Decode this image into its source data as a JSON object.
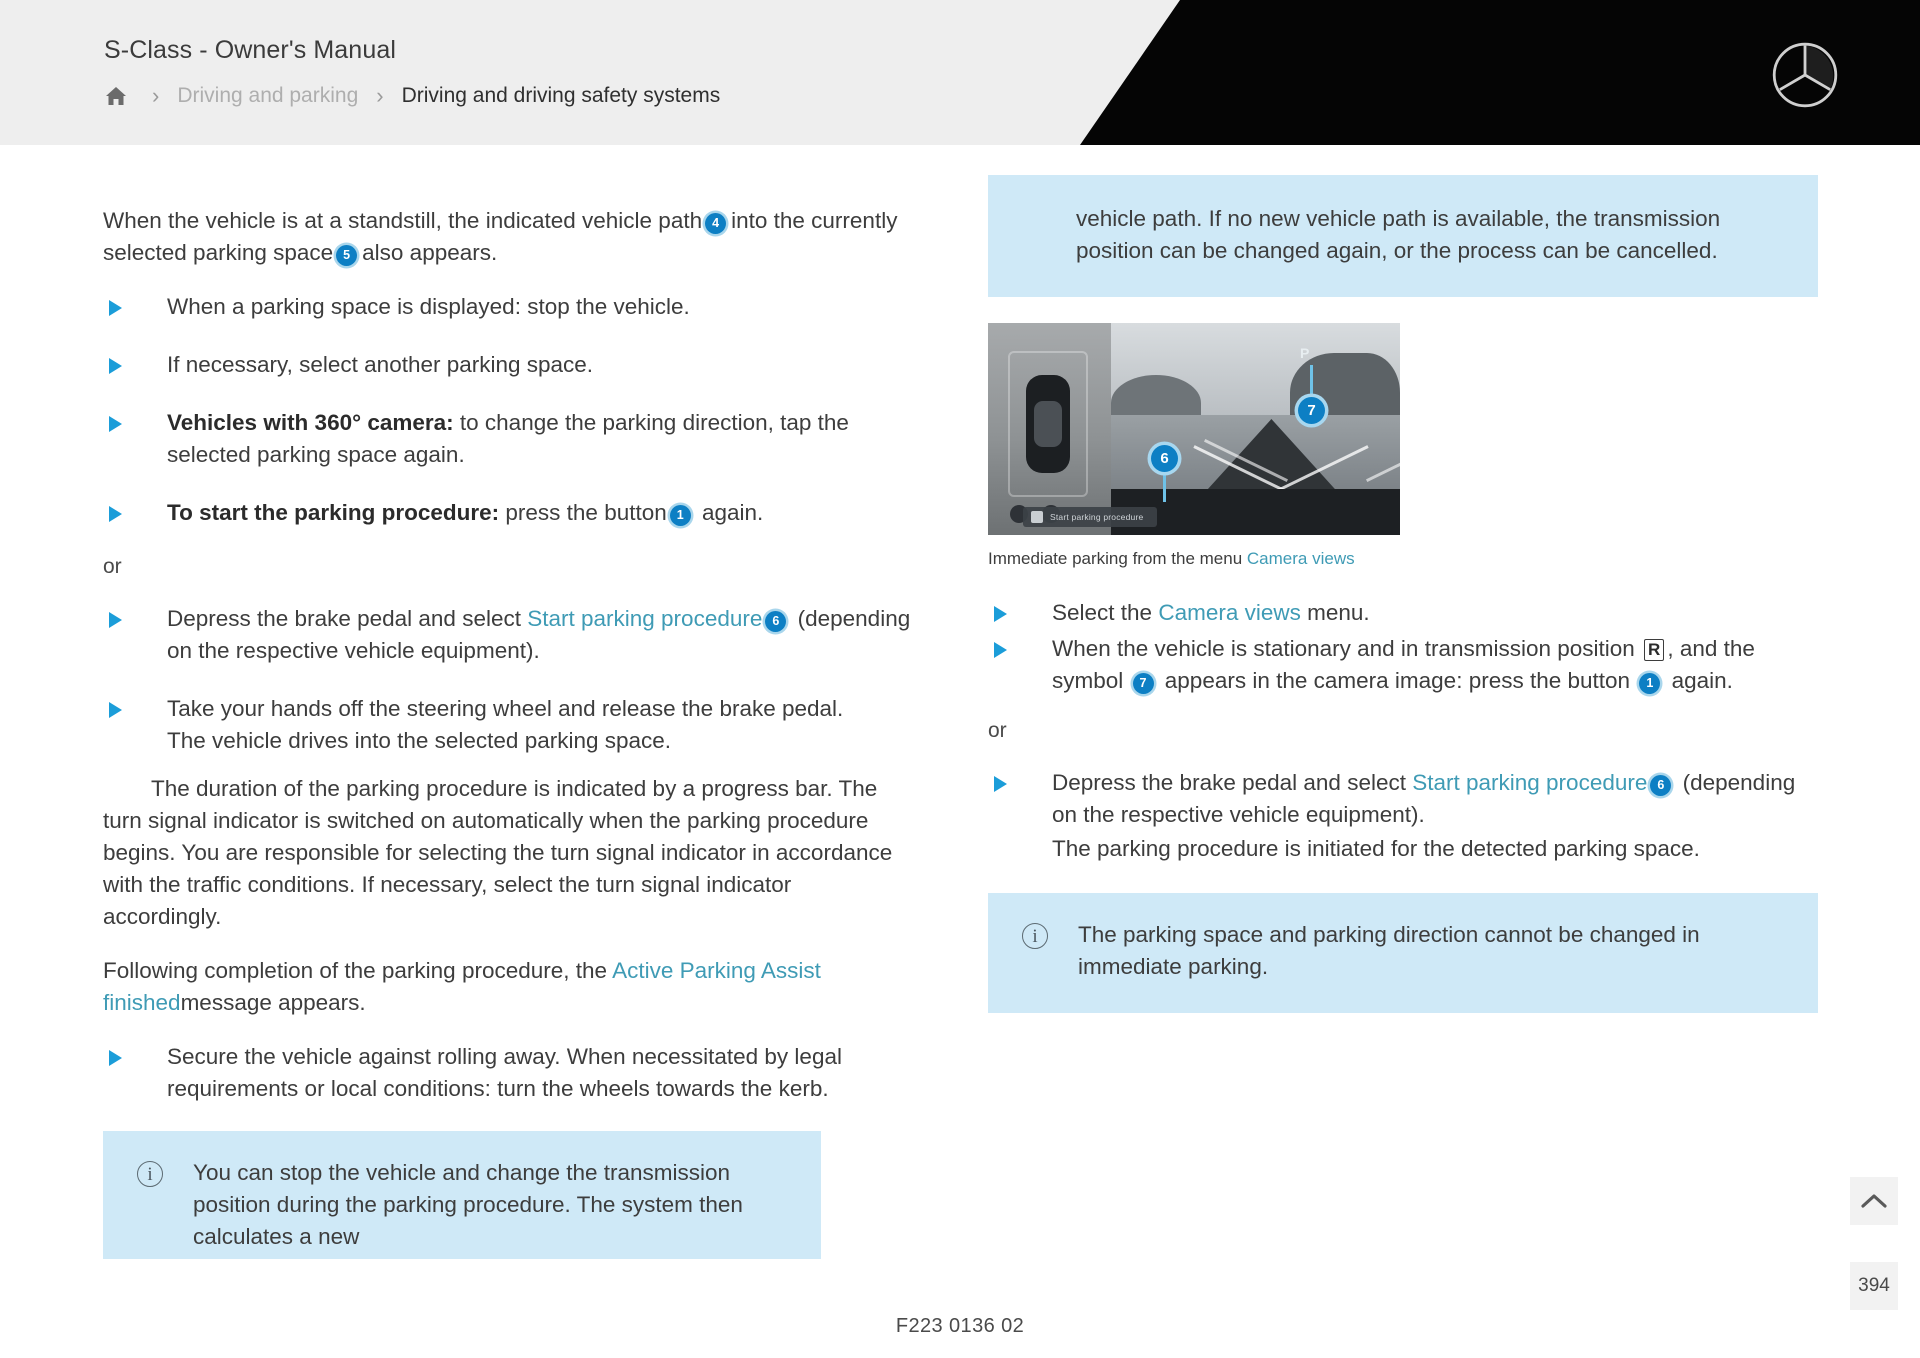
{
  "header": {
    "title": "S-Class - Owner's Manual",
    "home_icon": "home-icon",
    "breadcrumb": {
      "sep": "›",
      "level1": "Driving and parking",
      "level2": "Driving and driving safety systems"
    },
    "brand_logo": "mercedes-star-logo"
  },
  "left_column": {
    "lead_a": "When the vehicle is at a standstill, the indicated vehicle path",
    "lead_n1": "4",
    "lead_b": "into the currently selected parking space",
    "lead_n2": "5",
    "lead_c": "also appears.",
    "bullets": [
      {
        "text": "When a parking space is displayed: stop the vehicle."
      },
      {
        "text": "If necessary, select another parking space."
      },
      {
        "bold": "Vehicles with 360° camera:",
        "text": " to change the parking direction, tap the selected parking space again."
      },
      {
        "bold": "To start the parking procedure:",
        "text": " press the button",
        "num": "1",
        "text_after": " again."
      }
    ],
    "or": "or",
    "bullets2": [
      {
        "pre": "Depress the brake pedal and select ",
        "link": "Start parking procedure",
        "num": "6",
        "post": " (depending on the respective vehicle equipment)."
      },
      {
        "pre": "Take your hands off the steering wheel and release the brake pedal.",
        "sub": "The vehicle drives into the selected parking space."
      }
    ],
    "paragraph1": "The duration of the parking procedure is indicated by a progress bar. The turn signal indicator is switched on automatically when the parking procedure begins. You are responsible for selecting the turn signal indicator in accordance with the traffic conditions. If necessary, select the turn signal indicator accordingly.",
    "paragraph2_pre": "Following completion of the parking procedure, the ",
    "paragraph2_link": "Active Parking Assist finished",
    "paragraph2_post": "message appears.",
    "bullets3": [
      {
        "text": "Secure the vehicle against rolling away. When necessitated by legal requirements or local conditions: turn the wheels towards the kerb."
      }
    ],
    "infobox": {
      "icon": "info-icon",
      "text": "You can stop the vehicle and change the transmission position during the parking procedure. The system then calculates a new"
    }
  },
  "right_column": {
    "infobox_top": {
      "text": "vehicle path. If no new vehicle path is available, the transmission position can be changed again, or the process can be cancelled."
    },
    "figure": {
      "alt": "camera-view-parking-image",
      "button_label": "Start parking procedure",
      "callout_6": "6",
      "callout_7": "7",
      "marker_p": "P",
      "caption_pre": "Immediate parking from the menu ",
      "caption_link": "Camera views"
    },
    "bullets": [
      {
        "pre": "Select the ",
        "link": "Camera views",
        "post": " menu."
      },
      {
        "pre": "When the vehicle is stationary and in transmission position ",
        "boxed": "R",
        "mid": ", and the symbol ",
        "num1": "7",
        "mid2": " appears in the camera image: press the button ",
        "num2": "1",
        "post": " again."
      }
    ],
    "or": "or",
    "bullets2": [
      {
        "pre": "Depress the brake pedal and select ",
        "link": "Start parking procedure",
        "num": "6",
        "post": " (depending on the respective vehicle equipment).",
        "sub": "The parking procedure is initiated for the detected parking space."
      }
    ],
    "infobox_bottom": {
      "icon": "info-icon",
      "text": "The parking space and parking direction cannot be changed in immediate parking."
    }
  },
  "controls": {
    "scroll_up_icon": "chevron-up-icon",
    "page_number": "394"
  },
  "footer": {
    "document_code": "F223 0136 02"
  },
  "colors": {
    "accent_blue": "#0d7fc4",
    "link_teal": "#3f9bb5",
    "infobox_bg": "#cfe9f7",
    "header_bg": "#eeeeee",
    "header_black": "#050505"
  }
}
